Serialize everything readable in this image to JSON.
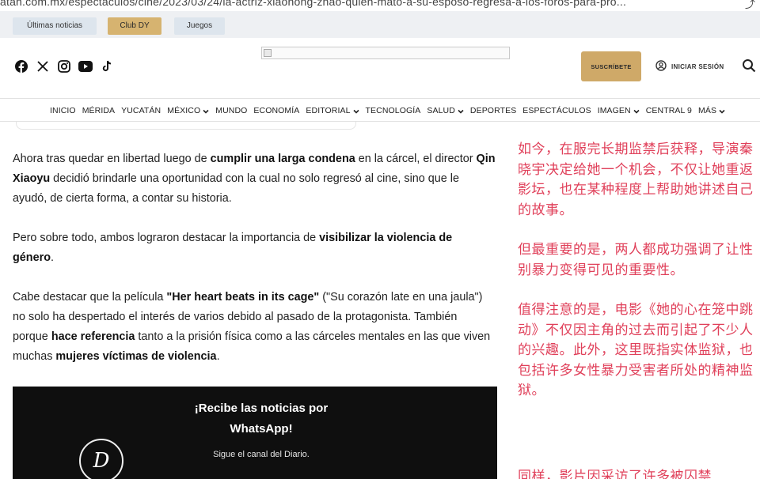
{
  "browser": {
    "url": "atan.com.mx/espectaculos/cine/2023/03/24/la-actriz-xiaohong-zhao-quien-mato-a-su-esposo-regresa-a-los-foros-para-pro...",
    "share_glyph": "⤴"
  },
  "top_tabs": [
    {
      "label": "Últimas noticias"
    },
    {
      "label": "Club DY"
    },
    {
      "label": "Juegos"
    }
  ],
  "header": {
    "social_icons": [
      "facebook-icon",
      "x-icon",
      "instagram-icon",
      "youtube-icon",
      "tiktok-icon"
    ],
    "subscribe_label": "SUSCRÍBETE",
    "login_label": "INICIAR SESIÓN",
    "colors": {
      "subscribe": "#cfa968",
      "club_tab": "#d6b370"
    }
  },
  "nav": {
    "items": [
      {
        "label": "INICIO",
        "dropdown": false
      },
      {
        "label": "MÉRIDA",
        "dropdown": false
      },
      {
        "label": "YUCATÁN",
        "dropdown": false
      },
      {
        "label": "MÉXICO",
        "dropdown": true
      },
      {
        "label": "MUNDO",
        "dropdown": false
      },
      {
        "label": "ECONOMÍA",
        "dropdown": false
      },
      {
        "label": "EDITORIAL",
        "dropdown": true
      },
      {
        "label": "TECNOLOGÍA",
        "dropdown": false
      },
      {
        "label": "SALUD",
        "dropdown": true
      },
      {
        "label": "DEPORTES",
        "dropdown": false
      },
      {
        "label": "ESPECTÁCULOS",
        "dropdown": false
      },
      {
        "label": "IMAGEN",
        "dropdown": true
      },
      {
        "label": "CENTRAL 9",
        "dropdown": false
      },
      {
        "label": "MÁS",
        "dropdown": true
      }
    ]
  },
  "article": {
    "p1": {
      "a": "Ahora tras quedar en libertad luego de ",
      "b": "cumplir una larga condena",
      "c": " en la cárcel, el director ",
      "d": "Qin Xiaoyu",
      "e": " decidió brindarle una oportunidad con la cual no solo regresó al cine, sino que le ayudó, de cierta forma, a contar su historia."
    },
    "p2": {
      "a": "Pero sobre todo, ambos lograron destacar la importancia de ",
      "b": "visibilizar la violencia de género",
      "c": "."
    },
    "p3": {
      "a": "Cabe destacar que la película ",
      "b": "\"Her heart beats in its cage\"",
      "c": " (\"Su corazón late en una jaula\") no solo ha despertado el interés de varios debido al pasado de la protagonista. También porque ",
      "d": "hace referencia",
      "e": " tanto a la prisión física como a las cárceles mentales en las que viven muchas ",
      "f": "mujeres víctimas de violencia",
      "g": "."
    }
  },
  "whatsapp_box": {
    "line1": "¡Recibe las noticias por",
    "line2": "WhatsApp!",
    "subtitle": "Sigue el canal del Diario.",
    "logo_letter": "D"
  },
  "translation": {
    "p1": "如今，在服完长期监禁后获释，导演秦晓宇决定给她一个机会，不仅让她重返影坛，也在某种程度上帮助她讲述自己的故事。",
    "p2": "但最重要的是，两人都成功强调了让性别暴力变得可见的重要性。",
    "p3": "值得注意的是，电影《她的心在笼中跳动》不仅因主角的过去而引起了不少人的兴趣。此外，这里既指实体监狱，也包括许多女性暴力受害者所处的精神监狱。",
    "p4_partial": "同样，影片因采访了许多被囚禁",
    "color": "#e0405a"
  }
}
